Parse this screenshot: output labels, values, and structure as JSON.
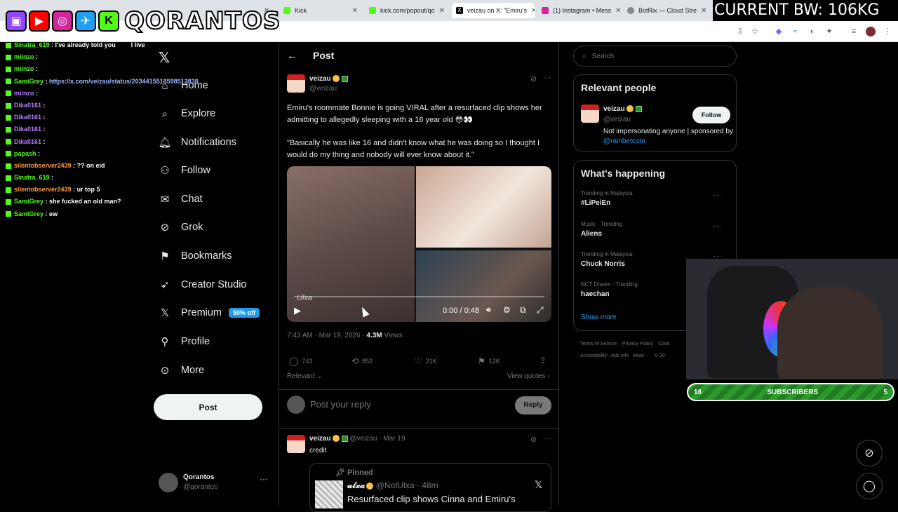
{
  "browser": {
    "tabs": [
      {
        "label": "",
        "active": false
      },
      {
        "label": "Kick",
        "active": false
      },
      {
        "label": "kick.com/popout/qo",
        "active": false
      },
      {
        "label": "veizau on X: \"Emiru's",
        "active": true
      },
      {
        "label": "(1) Instagram • Mess",
        "active": false
      },
      {
        "label": "BotRix — Cloud Stre",
        "active": false
      }
    ]
  },
  "overlay": {
    "brand": "QORANTOS",
    "bw_counter": "CURRENT BW: 106KG",
    "subscribers": {
      "label": "SUBSCRIBERS",
      "left": "16",
      "right": "5"
    }
  },
  "chat": [
    {
      "user": "Sinatra_619",
      "color": "green",
      "msg": "I've already told you",
      "tail": "I live"
    },
    {
      "user": "miinzo",
      "color": "green",
      "msg": ""
    },
    {
      "user": "miinzo",
      "color": "green",
      "msg": ""
    },
    {
      "user": "SamiGrey",
      "color": "green",
      "msg": "",
      "link": "https://x.com/veizau/status/2034415518598512838"
    },
    {
      "user": "miinzo",
      "color": "purple",
      "msg": ""
    },
    {
      "user": "Dika0161",
      "color": "purple",
      "msg": ""
    },
    {
      "user": "Dika0161",
      "color": "purple",
      "msg": ""
    },
    {
      "user": "Dika0161",
      "color": "purple",
      "msg": ""
    },
    {
      "user": "Dika0161",
      "color": "purple",
      "msg": ""
    },
    {
      "user": "papash",
      "color": "green",
      "msg": ""
    },
    {
      "user": "silentobserver2439",
      "color": "orange",
      "msg": "?? on eid"
    },
    {
      "user": "Sinatra_619",
      "color": "green",
      "msg": ""
    },
    {
      "user": "silentobserver2439",
      "color": "orange",
      "msg": "ur top 5"
    },
    {
      "user": "SamiGrey",
      "color": "green",
      "msg": "she fucked an old man?"
    },
    {
      "user": "SamiGrey",
      "color": "green",
      "msg": "ew"
    }
  ],
  "nav": {
    "items": [
      {
        "label": "Home",
        "icon": "home-icon",
        "glyph": "⌂"
      },
      {
        "label": "Explore",
        "icon": "search-icon",
        "glyph": "⌕"
      },
      {
        "label": "Notifications",
        "icon": "bell-icon",
        "glyph": "🔔︎"
      },
      {
        "label": "Follow",
        "icon": "person-add-icon",
        "glyph": "⚇"
      },
      {
        "label": "Chat",
        "icon": "mail-icon",
        "glyph": "✉"
      },
      {
        "label": "Grok",
        "icon": "grok-icon",
        "glyph": "⊘"
      },
      {
        "label": "Bookmarks",
        "icon": "bookmark-icon",
        "glyph": "⚑"
      },
      {
        "label": "Creator Studio",
        "icon": "rocket-icon",
        "glyph": "➶"
      },
      {
        "label": "Premium",
        "icon": "x-logo-icon",
        "glyph": "𝕏",
        "badge": "50% off"
      },
      {
        "label": "Profile",
        "icon": "person-icon",
        "glyph": "⚲"
      },
      {
        "label": "More",
        "icon": "more-circle-icon",
        "glyph": "⊙"
      }
    ],
    "post_button": "Post",
    "account": {
      "name": "Qorantos",
      "handle": "@qorantos"
    }
  },
  "post": {
    "header": "Post",
    "author": {
      "name": "veizau",
      "handle": "@veizau"
    },
    "text1": "Emiru's roommate Bonnie is going VIRAL after a resurfaced clip shows her admitting to allegedly sleeping with a 16 year old 😳👀",
    "text2": "\"Basically he was like 16 and didn't know what he was doing so I thought I would do my thing and nobody will ever know about it.\"",
    "video": {
      "time": "0:00 / 0:48",
      "watermark": "Ulxa",
      "progress": 0
    },
    "meta_time": "7:43 AM · Mar 19, 2026 · ",
    "views_count": "4.3M",
    "views_label": " Views",
    "stats": {
      "replies": "743",
      "reposts": "852",
      "likes": "21K",
      "bookmarks": "12K"
    },
    "sort_label": "Relevant",
    "view_quotes": "View quotes",
    "reply_placeholder": "Post your reply",
    "reply_button": "Reply"
  },
  "reply": {
    "author": "veizau",
    "handle_time": "@veizau · Mar 19",
    "text": "credit",
    "quote": {
      "pinned": "Pinned",
      "name": "𝓾𝓵𝔁𝓪",
      "handle_time": "@NotUlxa · 48m",
      "text": "Resurfaced clip shows Cinna and Emiru's"
    }
  },
  "right": {
    "search_placeholder": "Search",
    "relevant_title": "Relevant people",
    "person": {
      "name": "veizau",
      "handle": "@veizau",
      "bio": "Not impersonating anyone | sponsored by ",
      "bio_link": "@rainbetcom",
      "follow": "Follow"
    },
    "happening_title": "What's happening",
    "trends": [
      {
        "meta": "Trending in Malaysia",
        "name": "#LiPeiEn"
      },
      {
        "meta": "Music · Trending",
        "name": "Aliens"
      },
      {
        "meta": "Trending in Malaysia",
        "name": "Chuck Norris"
      },
      {
        "meta": "NCT Dream · Trending",
        "name": "haechan"
      }
    ],
    "show_more": "Show more",
    "footer1": [
      "Terms of Service",
      "Privacy Policy",
      "Cook"
    ],
    "footer2": [
      "Accessibility",
      "Ads info",
      "More ···",
      "© 20"
    ]
  },
  "colors": {
    "accent": "#1d9bf0",
    "kick_green": "#53fc18",
    "background": "#000000",
    "border": "#2f3336"
  }
}
